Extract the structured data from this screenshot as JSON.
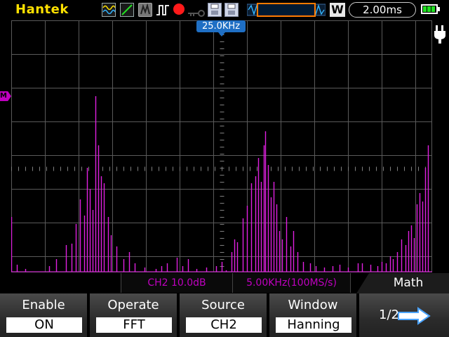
{
  "header": {
    "brand": "Hantek",
    "timebase": "2.00ms",
    "trigger_mode": "W",
    "icons": [
      "waveform-icon",
      "line-display-icon",
      "gray-mode-icon",
      "pulse-icon",
      "record-icon",
      "key-icon",
      "save-disk-icon",
      "save-disk-alt-icon",
      "memory-timeline-icon",
      "battery-icon"
    ]
  },
  "plot": {
    "center_frequency": "25.0KHz",
    "math_ref_label": "M",
    "trace_color": "#e020e0",
    "grid_color": "#5a5a5a"
  },
  "info": {
    "ch2_scale": "CH2 10.0dB",
    "fft_rate": "5.00KHz(100MS/s)",
    "menu_title": "Math"
  },
  "menu": {
    "items": [
      {
        "title": "Enable",
        "value": "ON"
      },
      {
        "title": "Operate",
        "value": "FFT"
      },
      {
        "title": "Source",
        "value": "CH2"
      },
      {
        "title": "Window",
        "value": "Hanning"
      }
    ],
    "page": "1/2"
  },
  "colors": {
    "brand": "#ffe100",
    "accent_math": "#c000c0",
    "marker": "#1f6fc4",
    "timeline_window": "#ff7b00",
    "battery": "#22e022"
  }
}
